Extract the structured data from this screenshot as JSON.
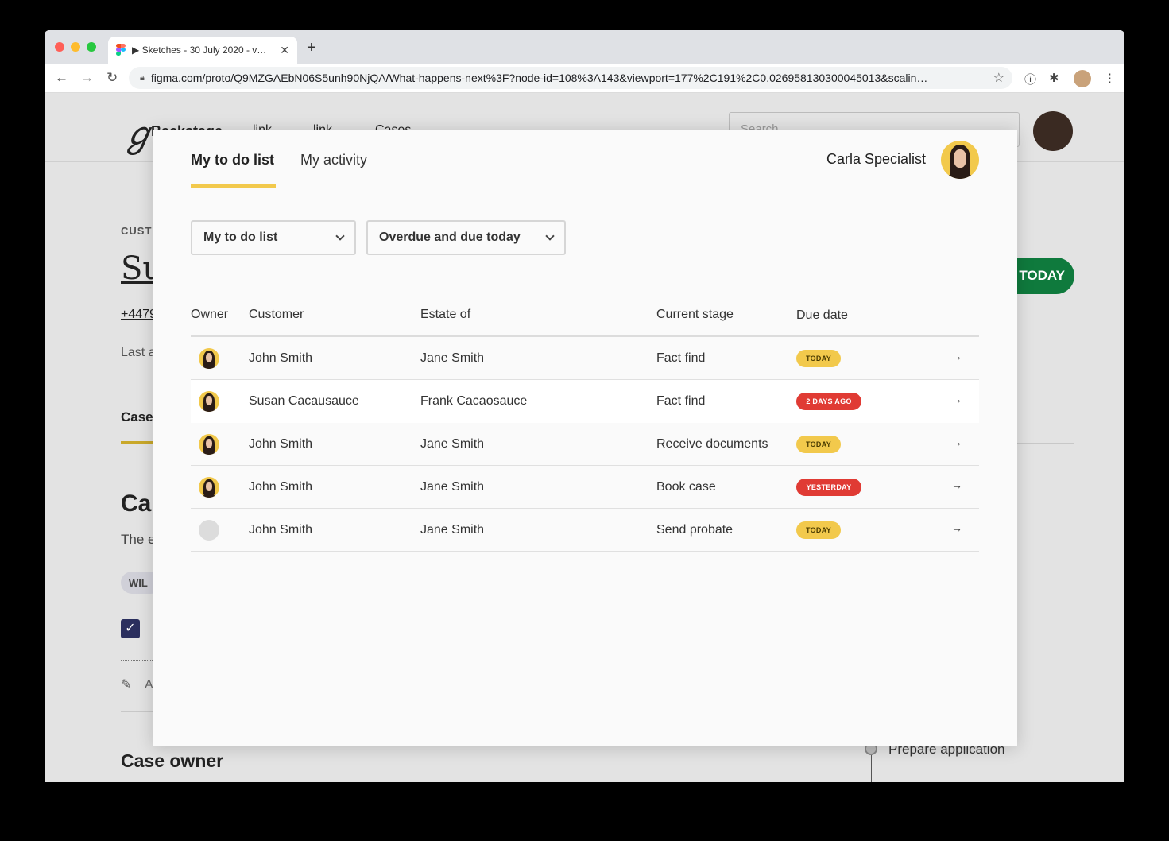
{
  "browser": {
    "tab_title": "▶ Sketches - 30 July 2020 - v…",
    "tab_close": "✕",
    "new_tab": "+",
    "url": "figma.com/proto/Q9MZGAEbN06S5unh90NjQA/What-happens-next%3F?node-id=108%3A143&viewport=177%2C191%2C0.026958130300045013&scalin…"
  },
  "background": {
    "nav": [
      "Backstage",
      "link",
      "link",
      "Cases"
    ],
    "search_placeholder": "Search",
    "section_label": "CUST",
    "heading_partial": "Su",
    "phone_partial": "+4479",
    "last_partial": "Last a",
    "tab_partial": "Case",
    "heading2_partial": "Ca",
    "body_partial": "The e",
    "pill_partial": "WIL",
    "edit_partial": "A",
    "today_button": "TODAY",
    "case_owner": "Case owner",
    "prepare_application": "Prepare application"
  },
  "modal": {
    "tabs": [
      {
        "label": "My to do list",
        "active": true
      },
      {
        "label": "My activity",
        "active": false
      }
    ],
    "user_name": "Carla Specialist",
    "filters": {
      "list_select": "My to do list",
      "due_select": "Overdue and due today"
    },
    "table": {
      "headers": [
        "Owner",
        "Customer",
        "Estate of",
        "Current stage",
        "Due date"
      ],
      "rows": [
        {
          "owner": "photo",
          "customer": "John Smith",
          "estate": "Jane Smith",
          "stage": "Fact find",
          "due": "TODAY",
          "due_status": "today",
          "highlight": false
        },
        {
          "owner": "photo",
          "customer": "Susan Cacausauce",
          "estate": "Frank Cacaosauce",
          "stage": "Fact find",
          "due": "2 DAYS AGO",
          "due_status": "overdue",
          "highlight": true
        },
        {
          "owner": "photo",
          "customer": "John Smith",
          "estate": "Jane Smith",
          "stage": "Receive documents",
          "due": "TODAY",
          "due_status": "today",
          "highlight": false
        },
        {
          "owner": "photo",
          "customer": "John Smith",
          "estate": "Jane Smith",
          "stage": "Book case",
          "due": "YESTERDAY",
          "due_status": "overdue",
          "highlight": false
        },
        {
          "owner": "empty",
          "customer": "John Smith",
          "estate": "Jane Smith",
          "stage": "Send probate",
          "due": "TODAY",
          "due_status": "today",
          "highlight": false
        }
      ],
      "row_action_icon": "arrow-right-icon"
    }
  },
  "colors": {
    "accent_yellow": "#f2c94c",
    "overdue_red": "#e03b34",
    "green_button": "#0f7a3d"
  }
}
